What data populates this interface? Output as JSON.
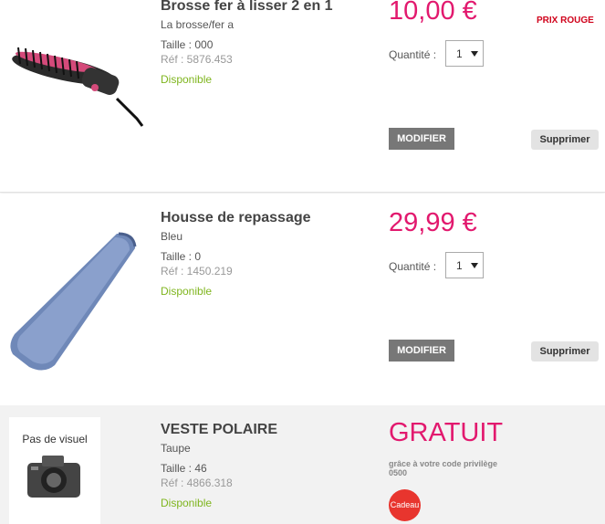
{
  "items": [
    {
      "title": "Brosse fer à lisser 2 en 1",
      "subtitle": "La brosse/fer a",
      "size": "Taille : 000",
      "ref": "Réf : 5876.453",
      "availability": "Disponible",
      "price": "10,00 €",
      "badge": "PRIX ROUGE",
      "quantity_label": "Quantité :",
      "quantity": "1",
      "modify_label": "MODIFIER",
      "remove_label": "Supprimer"
    },
    {
      "title": "Housse de repassage",
      "subtitle": "Bleu",
      "size": "Taille : 0",
      "ref": "Réf : 1450.219",
      "availability": "Disponible",
      "price": "29,99 €",
      "quantity_label": "Quantité :",
      "quantity": "1",
      "modify_label": "MODIFIER",
      "remove_label": "Supprimer"
    },
    {
      "title": "VESTE POLAIRE",
      "subtitle": "Taupe",
      "size": "Taille : 46",
      "ref": "Réf : 4866.318",
      "availability": "Disponible",
      "price": "GRATUIT",
      "gift_note_line1": "grâce à votre code privilège",
      "gift_note_line2": "0500",
      "gift_badge": "Cadeau",
      "no_image_label": "Pas de visuel"
    }
  ],
  "colors": {
    "price": "#e2196e",
    "available": "#7fb51e",
    "badge": "#d0021b",
    "gift": "#e8352e"
  }
}
